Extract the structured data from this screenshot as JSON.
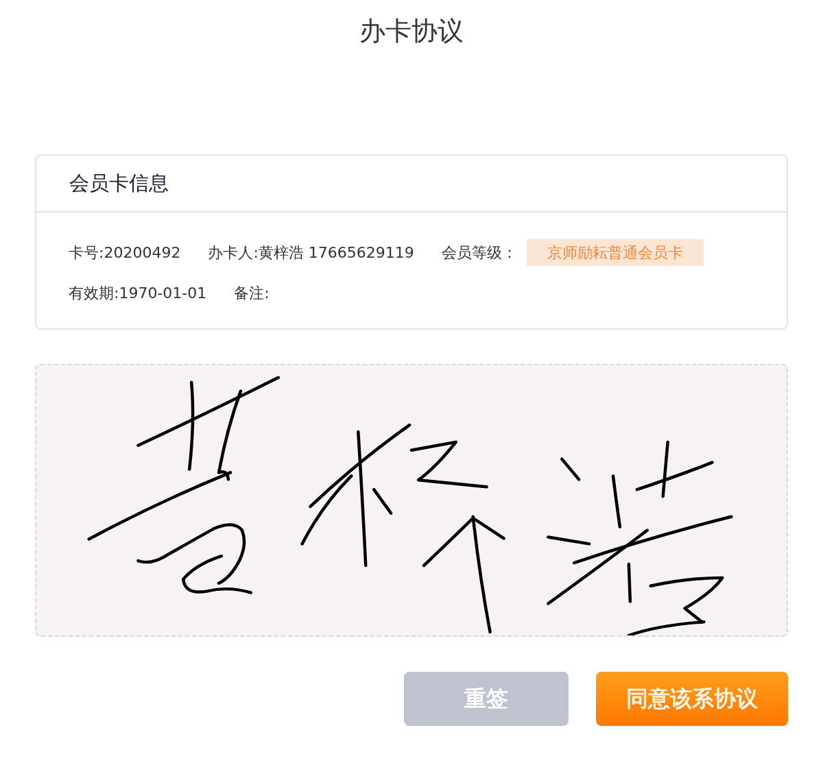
{
  "title": "办卡协议",
  "card": {
    "heading": "会员卡信息",
    "rows": [
      {
        "items": [
          {
            "kind": "text",
            "text": "卡号:20200492"
          },
          {
            "kind": "text",
            "text": "办卡人:黄梓浩 17665629119"
          },
          {
            "kind": "tag",
            "label": "会员等级：",
            "tag": "京师励耘普通会员卡"
          }
        ]
      },
      {
        "items": [
          {
            "kind": "text",
            "text": "有效期:1970-01-01"
          },
          {
            "kind": "text",
            "text": "备注:"
          }
        ]
      }
    ]
  },
  "signature_pad": {
    "signed": true
  },
  "buttons": [
    {
      "label": "重签",
      "kind": "secondary"
    },
    {
      "label": "同意该系协议",
      "kind": "primary"
    }
  ]
}
